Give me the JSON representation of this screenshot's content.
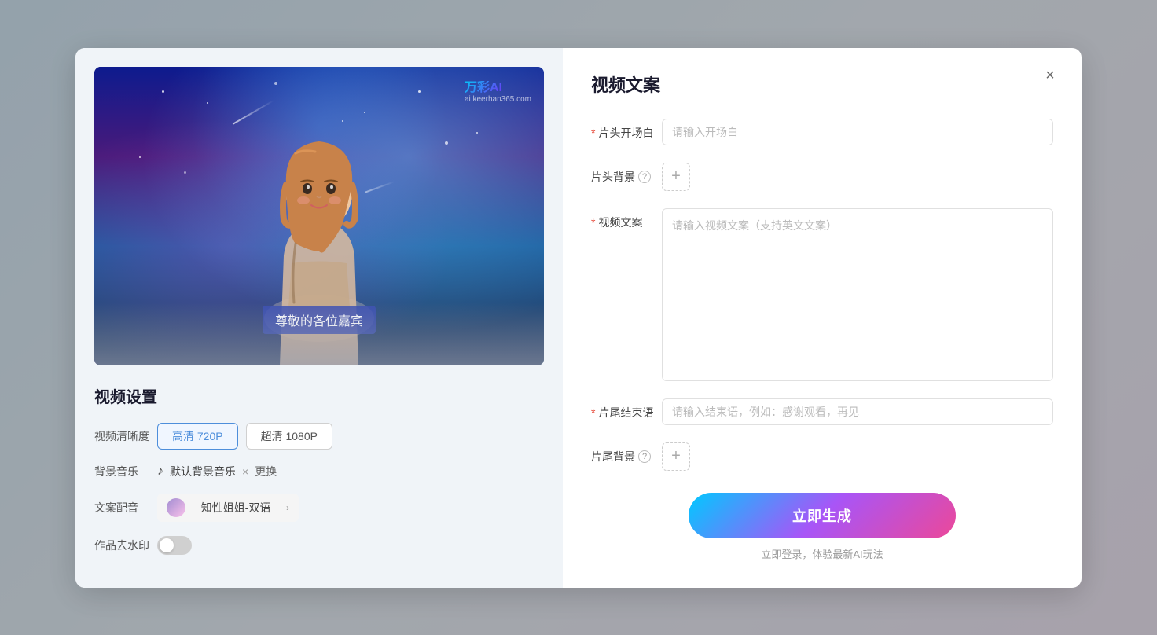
{
  "modal": {
    "right_panel_title": "视频文案",
    "close_button_label": "×"
  },
  "video_preview": {
    "watermark_brand": "万彩AI",
    "watermark_site": "ai.keerhan365.com",
    "subtitle_text": "尊敬的各位嘉宾"
  },
  "settings": {
    "title": "视频设置",
    "quality_label": "视频清晰度",
    "quality_options": [
      {
        "label": "高清 720P",
        "active": true
      },
      {
        "label": "超清 1080P",
        "active": false
      }
    ],
    "music_label": "背景音乐",
    "music_name": "默认背景音乐",
    "music_change": "更换",
    "voice_label": "文案配音",
    "voice_name": "知性姐姐-双语",
    "watermark_label": "作品去水印"
  },
  "form": {
    "opening_label": "片头开场白",
    "opening_required": true,
    "opening_placeholder": "请输入开场白",
    "bg_label": "片头背景",
    "bg_help": true,
    "content_label": "视频文案",
    "content_required": true,
    "content_placeholder": "请输入视频文案（支持英文文案）",
    "ending_label": "片尾结束语",
    "ending_required": true,
    "ending_placeholder": "请输入结束语，例如：感谢观看，再见",
    "ending_bg_label": "片尾背景",
    "ending_bg_help": true
  },
  "generate": {
    "button_label": "立即生成",
    "hint_text": "立即登录，体验最新AI玩法"
  }
}
